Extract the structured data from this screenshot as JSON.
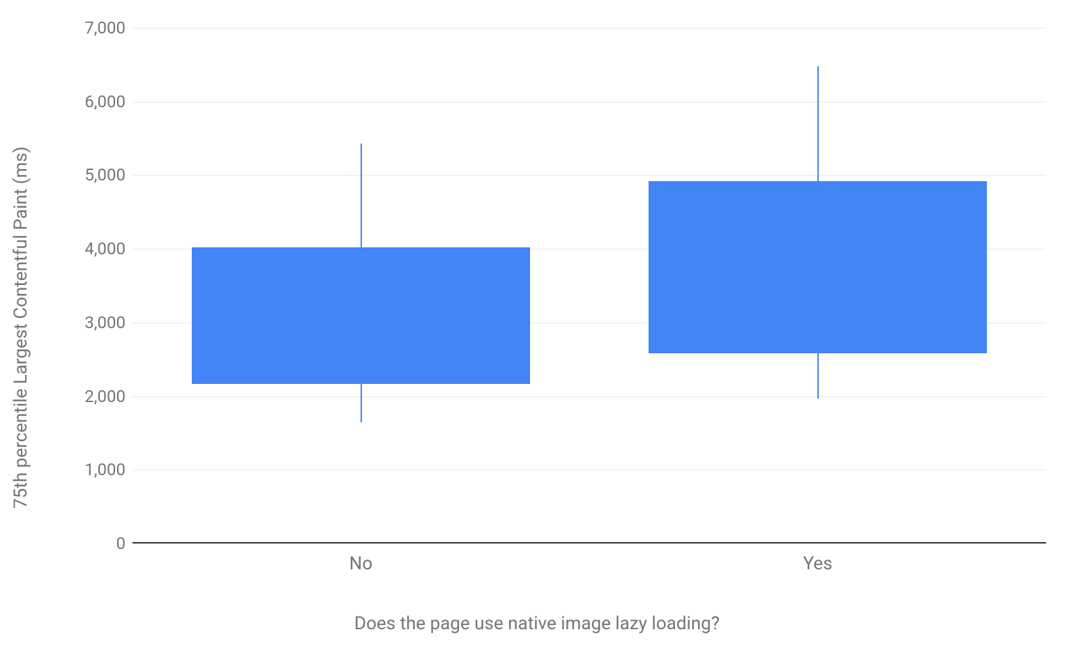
{
  "chart_data": {
    "type": "boxplot",
    "xlabel": "Does the page use native image lazy loading?",
    "ylabel": "75th percentile Largest Contentful Paint (ms)",
    "ylim": [
      0,
      7000
    ],
    "y_ticks": [
      0,
      1000,
      2000,
      3000,
      4000,
      5000,
      6000,
      7000
    ],
    "y_tick_labels": [
      "0",
      "1,000",
      "2,000",
      "3,000",
      "4,000",
      "5,000",
      "6,000",
      "7,000"
    ],
    "categories": [
      "No",
      "Yes"
    ],
    "series": [
      {
        "name": "No",
        "low": 1650,
        "q1": 2170,
        "q3": 4020,
        "high": 5430
      },
      {
        "name": "Yes",
        "low": 1970,
        "q1": 2580,
        "q3": 4920,
        "high": 6480
      }
    ],
    "box_color": "#4285f4"
  }
}
